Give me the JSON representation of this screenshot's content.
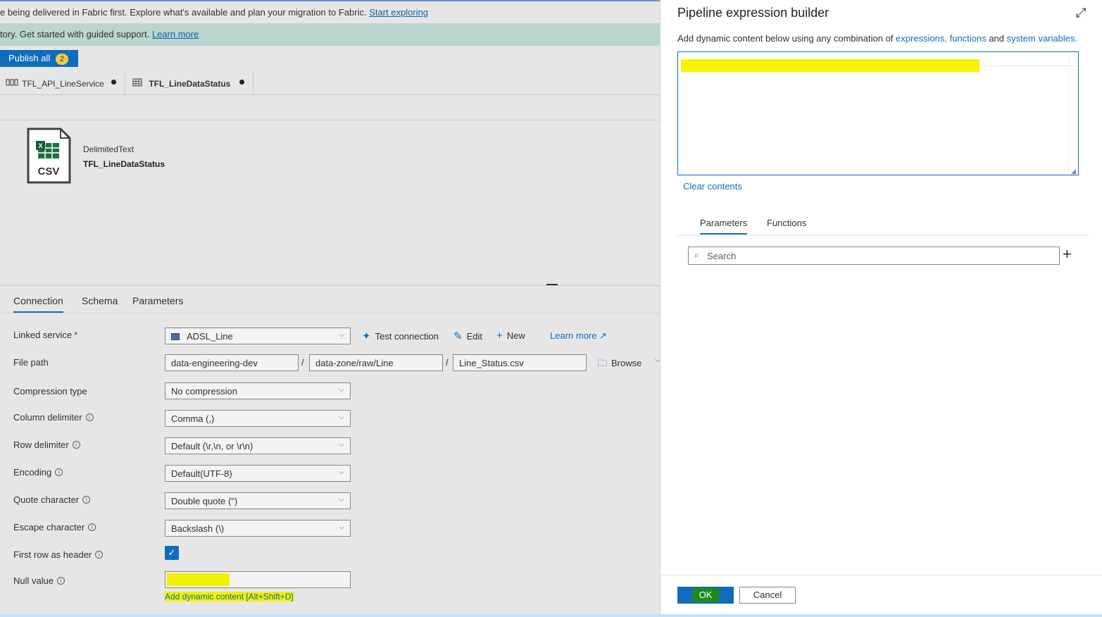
{
  "banners": {
    "fabric_text": "e being delivered in Fabric first. Explore what's available and plan your migration to Fabric.",
    "fabric_link": "Start exploring",
    "factory_text": "tory. Get started with guided support.",
    "factory_link": "Learn more"
  },
  "toolbar": {
    "publish_label": "Publish all",
    "publish_count": "2"
  },
  "doc_tabs": [
    {
      "label": "TFL_API_LineService",
      "icon": "pipeline-icon"
    },
    {
      "label": "TFL_LineDataStatus",
      "icon": "table-icon"
    }
  ],
  "dataset": {
    "icon_text": "CSV",
    "type": "DelimitedText",
    "name": "TFL_LineDataStatus"
  },
  "props_tabs": [
    "Connection",
    "Schema",
    "Parameters"
  ],
  "connection": {
    "linked_service": {
      "label": "Linked service",
      "required": "*",
      "value": "ADSL_Line"
    },
    "actions": {
      "test": "Test connection",
      "edit": "Edit",
      "new": "New",
      "learn": "Learn more"
    },
    "file_path": {
      "label": "File path",
      "container": "data-engineering-dev",
      "directory": "data-zone/raw/Line",
      "file": "Line_Status.csv",
      "sep": "/",
      "browse": "Browse"
    },
    "compression": {
      "label": "Compression type",
      "value": "No compression"
    },
    "column_delimiter": {
      "label": "Column delimiter",
      "value": "Comma (,)"
    },
    "row_delimiter": {
      "label": "Row delimiter",
      "value": "Default (\\r,\\n, or \\r\\n)"
    },
    "encoding": {
      "label": "Encoding",
      "value": "Default(UTF-8)"
    },
    "quote_char": {
      "label": "Quote character",
      "value": "Double quote (\")"
    },
    "escape_char": {
      "label": "Escape character",
      "value": "Backslash (\\)"
    },
    "first_row_header": {
      "label": "First row as header",
      "checked": true
    },
    "null_value": {
      "label": "Null value",
      "value": ""
    },
    "dynamic_link": "Add dynamic content [Alt+Shift+D]"
  },
  "panel": {
    "title": "Pipeline expression builder",
    "desc_prefix": "Add dynamic content below using any combination of",
    "link_expressions": "expressions,",
    "link_functions": "functions",
    "and": "and",
    "link_system_vars": "system variables.",
    "clear": "Clear contents",
    "tabs": [
      "Parameters",
      "Functions"
    ],
    "search_placeholder": "Search",
    "ok": "OK",
    "cancel": "Cancel"
  },
  "colors": {
    "accent": "#0f6cbd",
    "highlight": "#f0f000",
    "ok_highlight": "#1e8a1e"
  }
}
